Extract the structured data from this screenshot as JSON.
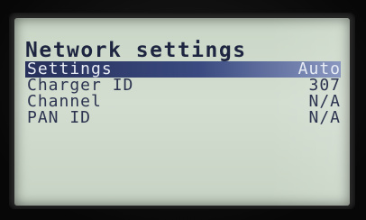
{
  "screen": {
    "title": "Network settings",
    "rows": [
      {
        "label": "Settings",
        "value": "Auto",
        "selected": true
      },
      {
        "label": "Charger ID",
        "value": "307",
        "selected": false
      },
      {
        "label": "Channel",
        "value": "N/A",
        "selected": false
      },
      {
        "label": "PAN ID",
        "value": "N/A",
        "selected": false
      }
    ]
  },
  "colors": {
    "lcd_background": "#cfdacb",
    "text": "#2c3450",
    "highlight": "#2f3b6a"
  }
}
